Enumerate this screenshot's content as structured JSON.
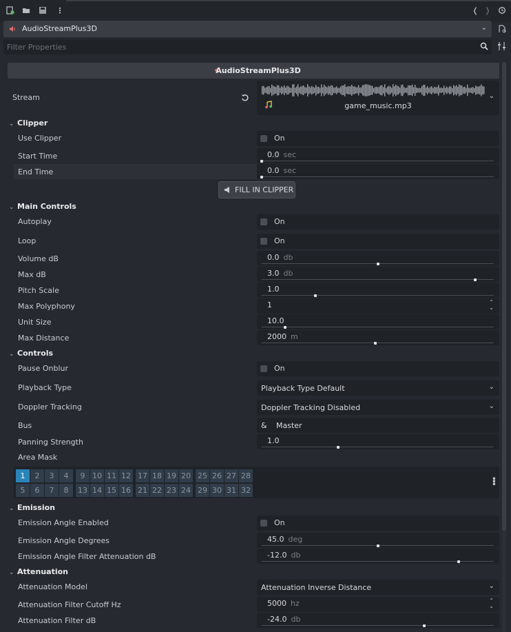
{
  "toolbar": {
    "icons": [
      "new-resource-icon",
      "open-icon",
      "save-icon",
      "more-icon"
    ],
    "nav": [
      "<",
      ">"
    ]
  },
  "node_selector": {
    "value": "AudioStreamPlus3D"
  },
  "filter": {
    "placeholder": "Filter Properties"
  },
  "header": {
    "title": "AudioStreamPlus3D"
  },
  "stream": {
    "label": "Stream",
    "file": "game_music.mp3"
  },
  "sections": {
    "clipper": "Clipper",
    "main_controls": "Main Controls",
    "controls": "Controls",
    "emission": "Emission",
    "attenuation": "Attenuation"
  },
  "props": {
    "use_clipper": {
      "label": "Use Clipper",
      "value": "On"
    },
    "start_time": {
      "label": "Start Time",
      "value": "0.0",
      "unit": "sec",
      "slider": 0.0
    },
    "end_time": {
      "label": "End Time",
      "value": "0.0",
      "unit": "sec",
      "slider": 0.0
    },
    "fill_in_clipper": "FILL IN CLIPPER",
    "autoplay": {
      "label": "Autoplay",
      "value": "On"
    },
    "loop": {
      "label": "Loop",
      "value": "On"
    },
    "volume_db": {
      "label": "Volume dB",
      "value": "0.0",
      "unit": "db",
      "slider": 0.5
    },
    "max_db": {
      "label": "Max dB",
      "value": "3.0",
      "unit": "db",
      "slider": 0.92
    },
    "pitch_scale": {
      "label": "Pitch Scale",
      "value": "1.0",
      "slider": 0.23
    },
    "max_polyphony": {
      "label": "Max Polyphony",
      "value": "1"
    },
    "unit_size": {
      "label": "Unit Size",
      "value": "10.0",
      "slider": 0.1
    },
    "max_distance": {
      "label": "Max Distance",
      "value": "2000",
      "unit": "m",
      "slider": 0.49
    },
    "pause_onblur": {
      "label": "Pause Onblur",
      "value": "On"
    },
    "playback_type": {
      "label": "Playback Type",
      "value": "Playback Type Default"
    },
    "doppler_tracking": {
      "label": "Doppler Tracking",
      "value": "Doppler Tracking Disabled"
    },
    "bus": {
      "label": "Bus",
      "prefix": "&",
      "value": "Master"
    },
    "panning_strength": {
      "label": "Panning Strength",
      "value": "1.0",
      "slider": 0.33
    },
    "area_mask": {
      "label": "Area Mask",
      "bits_row1": [
        "1",
        "2",
        "3",
        "4",
        "9",
        "10",
        "11",
        "12",
        "17",
        "18",
        "19",
        "20",
        "25",
        "26",
        "27",
        "28"
      ],
      "bits_row2": [
        "5",
        "6",
        "7",
        "8",
        "13",
        "14",
        "15",
        "16",
        "21",
        "22",
        "23",
        "24",
        "29",
        "30",
        "31",
        "32"
      ],
      "active": [
        "1"
      ]
    },
    "emission_angle_enabled": {
      "label": "Emission Angle Enabled",
      "value": "On"
    },
    "emission_angle_degrees": {
      "label": "Emission Angle Degrees",
      "value": "45.0",
      "unit": "deg",
      "slider": 0.5
    },
    "emission_angle_filter_attenuation_db": {
      "label": "Emission Angle Filter Attenuation dB",
      "value": "-12.0",
      "unit": "db",
      "slider": 0.85
    },
    "attenuation_model": {
      "label": "Attenuation Model",
      "value": "Attenuation Inverse Distance"
    },
    "attenuation_filter_cutoff_hz": {
      "label": "Attenuation Filter Cutoff Hz",
      "value": "5000",
      "unit": "hz"
    },
    "attenuation_filter_db": {
      "label": "Attenuation Filter dB",
      "value": "-24.0",
      "unit": "db",
      "slider": 0.7
    }
  },
  "colors": {
    "accent": "#2a84b8",
    "speaker": "#e06c6c",
    "bg": "#262a30",
    "field": "#1f2328"
  }
}
